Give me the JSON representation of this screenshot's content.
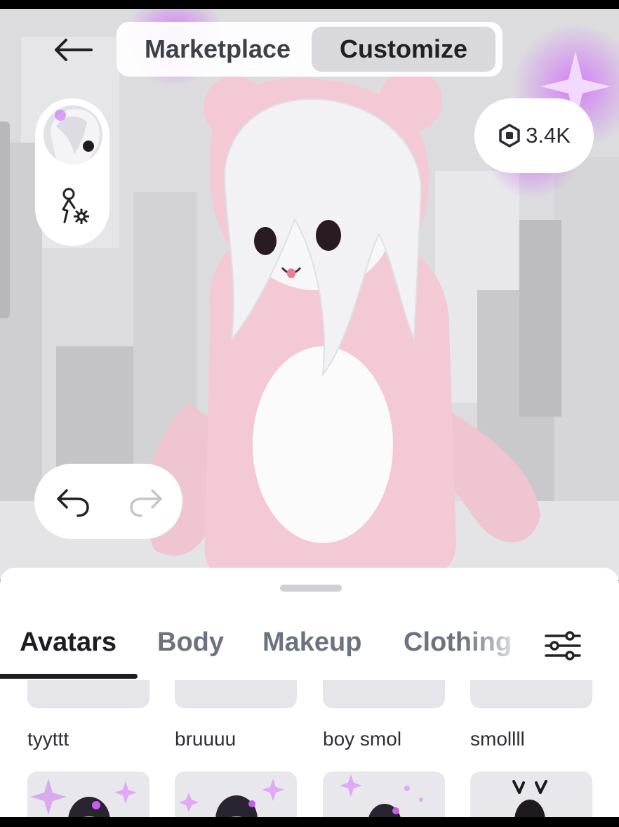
{
  "header": {
    "tabs": [
      {
        "label": "Marketplace",
        "active": false
      },
      {
        "label": "Customize",
        "active": true
      }
    ]
  },
  "currency": {
    "amount": "3.4K",
    "icon": "robux-icon"
  },
  "bottom_tabs": [
    {
      "label": "Avatars",
      "active": true
    },
    {
      "label": "Body",
      "active": false
    },
    {
      "label": "Makeup",
      "active": false
    },
    {
      "label": "Clothing",
      "active": false
    }
  ],
  "avatars": [
    {
      "name": "tyyttt"
    },
    {
      "name": "bruuuu"
    },
    {
      "name": "boy smol"
    },
    {
      "name": "smollll"
    }
  ],
  "colors": {
    "sparkle": "#c86bf0",
    "avatar_pink": "#f2c6d3",
    "accent_dark": "#1c1d21"
  }
}
